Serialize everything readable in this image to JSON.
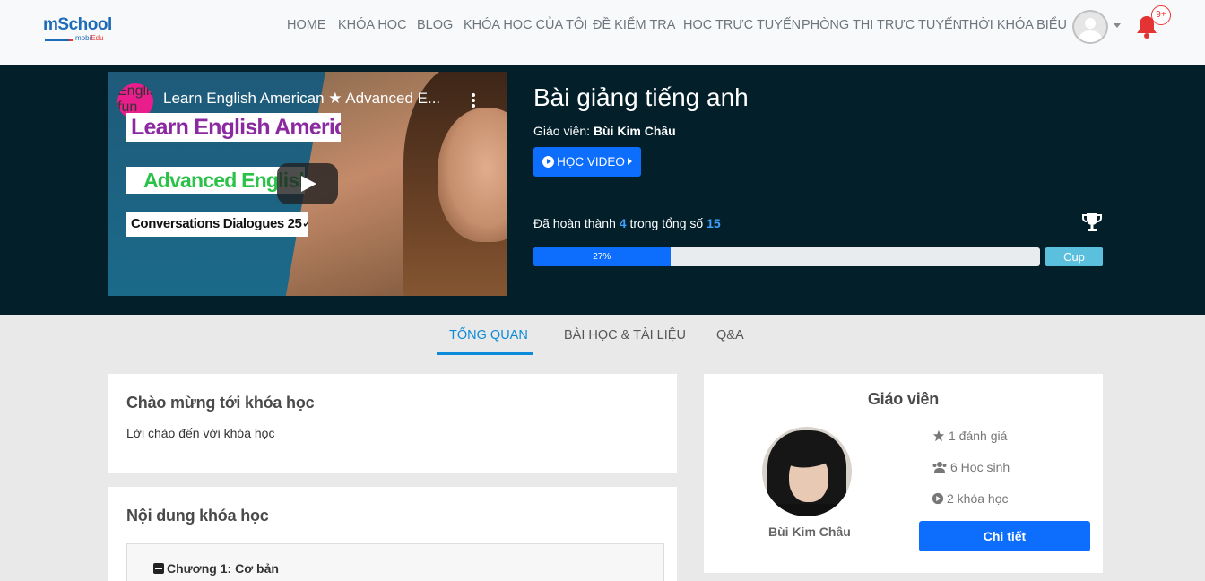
{
  "logo": {
    "brand": "mSchool",
    "sub_prefix": "mobi",
    "sub_suffix": "Edu"
  },
  "nav": [
    {
      "label": "HOME"
    },
    {
      "label": "KHÓA HỌC"
    },
    {
      "label": "BLOG"
    },
    {
      "label": "KHÓA HỌC CỦA TÔI"
    },
    {
      "label": "ĐỀ KIỂM TRA"
    },
    {
      "label": "HỌC TRỰC TUYẾN"
    },
    {
      "label": "PHÒNG THI TRỰC TUYẾN"
    },
    {
      "label": "THỜI KHÓA BIỂU"
    }
  ],
  "notifications": {
    "count": "9+"
  },
  "video": {
    "title": "Learn English American ★ Advanced E...",
    "channel": "English fun",
    "line1": "Learn English American",
    "line2": "Advanced English",
    "line3": "Conversations Dialogues 25✓"
  },
  "course": {
    "title": "Bài giảng tiếng anh",
    "teacher_label": "Giáo viên:",
    "teacher_name": "Bùi Kim Châu",
    "video_button": "HỌC VIDEO",
    "progress_prefix": "Đã hoàn thành",
    "completed": "4",
    "progress_middle": "trong tổng số",
    "total": "15",
    "progress_percent_label": "27%",
    "progress_fraction": 0.27,
    "cup_label": "Cup"
  },
  "tabs": [
    {
      "label": "TỔNG QUAN",
      "active": true
    },
    {
      "label": "BÀI HỌC & TÀI LIỆU",
      "active": false
    },
    {
      "label": "Q&A",
      "active": false
    }
  ],
  "welcome": {
    "title": "Chào mừng tới khóa học",
    "text": "Lời chào đến với khóa học"
  },
  "content": {
    "title": "Nội dung khóa học",
    "chapter": "Chương 1: Cơ bản"
  },
  "teacher_card": {
    "title": "Giáo viên",
    "name": "Bùi Kim Châu",
    "rating": "1 đánh giá",
    "students": "6 Học sinh",
    "courses": "2 khóa học",
    "detail_button": "Chi tiết"
  },
  "colors": {
    "primary": "#0d6efd",
    "hero_bg": "#021f2a",
    "accent": "#0d8bd8",
    "cup": "#5bc0de",
    "bell": "#e33333"
  }
}
